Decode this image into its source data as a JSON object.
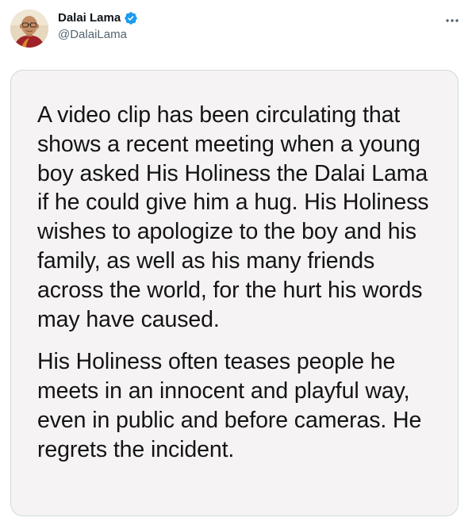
{
  "author": {
    "display_name": "Dalai Lama",
    "handle": "@DalaiLama",
    "verified": true,
    "verified_color": "#1d9bf0",
    "avatar_icon": "avatar-photo"
  },
  "menu": {
    "icon": "more-horizontal-icon"
  },
  "statement": {
    "paragraphs": [
      "A video clip has been circulating that shows a recent meeting when a young boy asked His Holiness the Dalai Lama if he could give him a hug. His Holiness wishes to apologize to the boy and his family, as well as his many friends across the world, for the hurt his words may have caused.",
      "His Holiness often teases people he meets in an innocent and playful way, even in public and before cameras. He regrets the incident."
    ]
  },
  "colors": {
    "card_background": "#f5f3f4",
    "card_border": "#cfd9de",
    "text_primary": "#0f1419",
    "text_secondary": "#536471"
  }
}
